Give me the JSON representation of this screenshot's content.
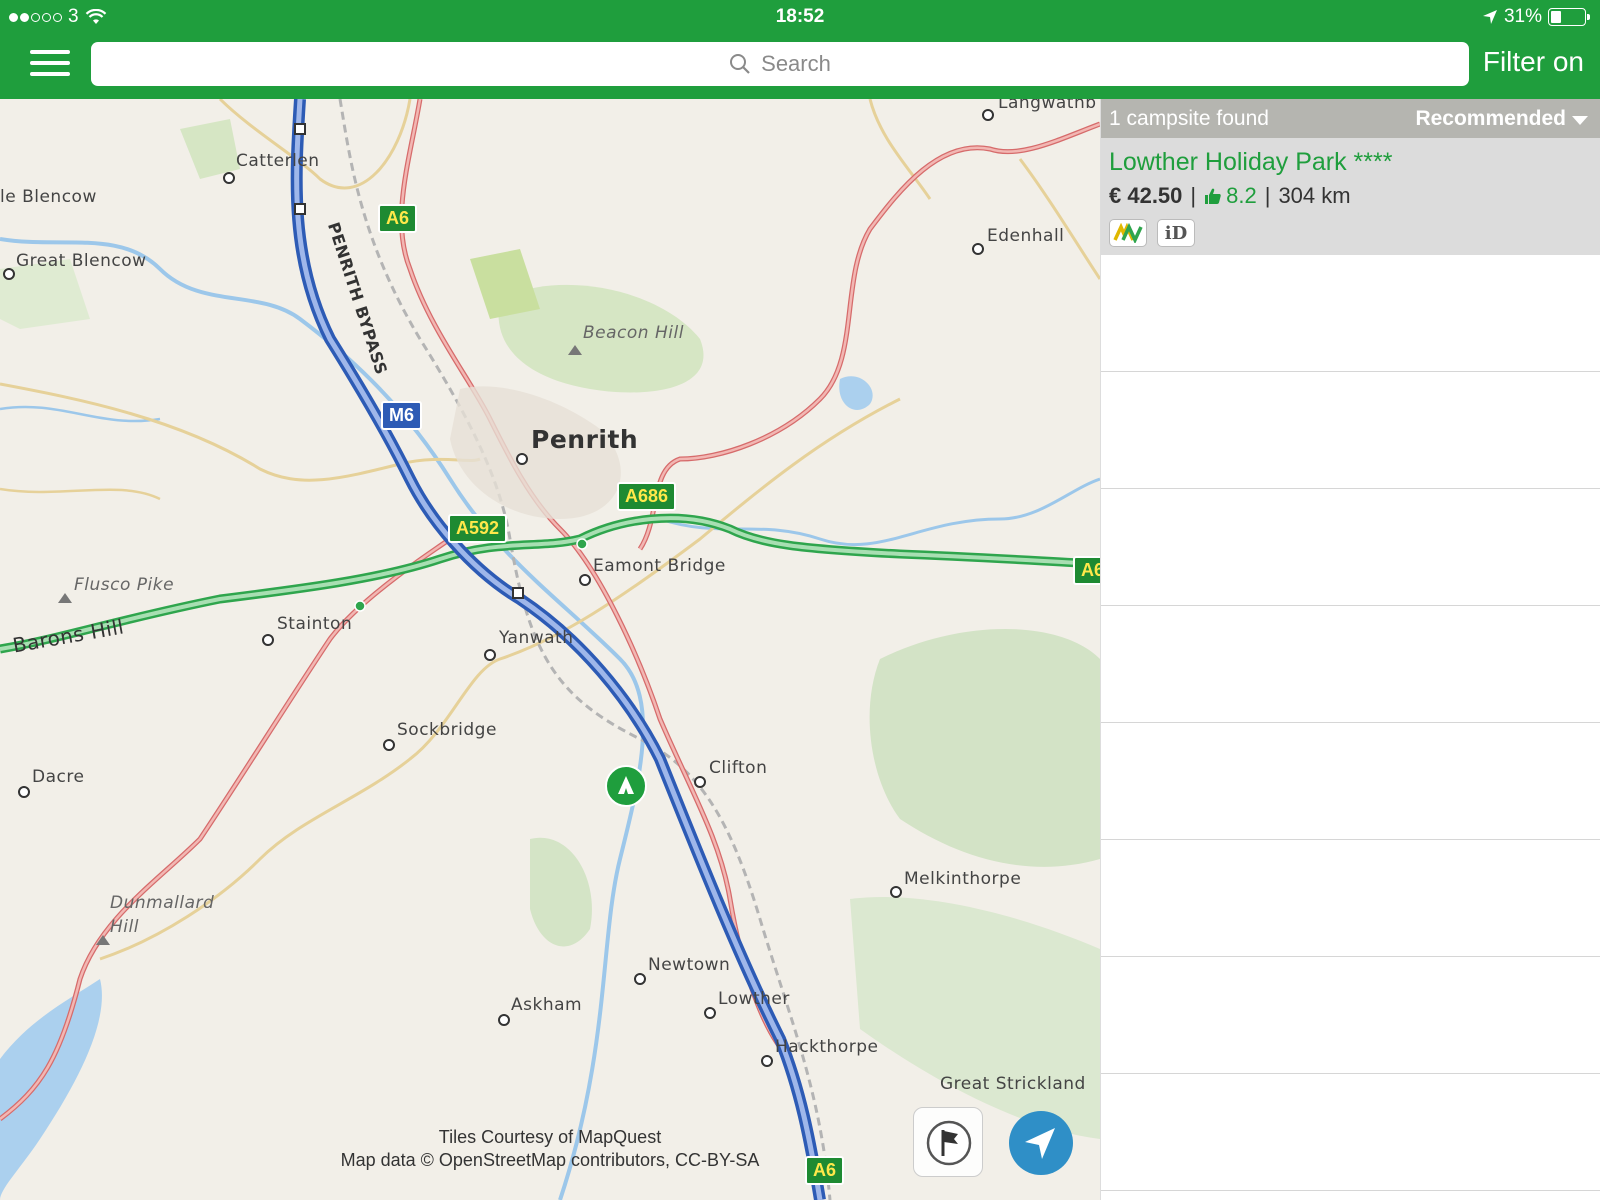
{
  "status_bar": {
    "carrier": "3",
    "time": "18:52",
    "battery_percent": "31%",
    "battery_level": 0.31
  },
  "top_bar": {
    "search_placeholder": "Search",
    "filter_label": "Filter on"
  },
  "map": {
    "places": {
      "catterlen": "Catterlen",
      "little_blencow": "le Blencow",
      "great_blencow": "Great Blencow",
      "penrith_bypass": "PENRITH BYPASS",
      "beacon_hill": "Beacon Hill",
      "penrith": "Penrith",
      "edenhall": "Edenhall",
      "langwathby": "Langwathb",
      "eamont_bridge": "Eamont Bridge",
      "flusco_pike": "Flusco Pike",
      "barons_hill": "Barons Hill",
      "stainton": "Stainton",
      "yanwath": "Yanwath",
      "sockbridge": "Sockbridge",
      "dacre": "Dacre",
      "clifton": "Clifton",
      "dunmallard_hill": "Dunmallard Hill",
      "melkinthorpe": "Melkinthorpe",
      "newtown": "Newtown",
      "askham": "Askham",
      "lowther": "Lowther",
      "hackthorpe": "Hackthorpe",
      "great_strickland": "Great Strickland"
    },
    "road_labels": {
      "a6_north": "A6",
      "m6": "M6",
      "a592": "A592",
      "a686": "A686",
      "a6_south": "A6",
      "a66_east": "A6"
    },
    "attribution_line1": "Tiles Courtesy of MapQuest",
    "attribution_line2": "Map data © OpenStreetMap contributors, CC-BY-SA"
  },
  "results": {
    "count_label": "1 campsite found",
    "sort_label": "Recommended",
    "items": [
      {
        "name": "Lowther Holiday Park ****",
        "price": "€ 42.50",
        "rating": "8.2",
        "distance": "304 km",
        "badges": [
          "acsi-logo-icon",
          "id-badge-icon"
        ],
        "badge_id_text": "iD"
      }
    ]
  },
  "colors": {
    "brand_green": "#1f9e3d",
    "locate_blue": "#2f8fc7",
    "road_shield_green": "#1e8a32",
    "motorway_blue": "#2d5bb5"
  }
}
